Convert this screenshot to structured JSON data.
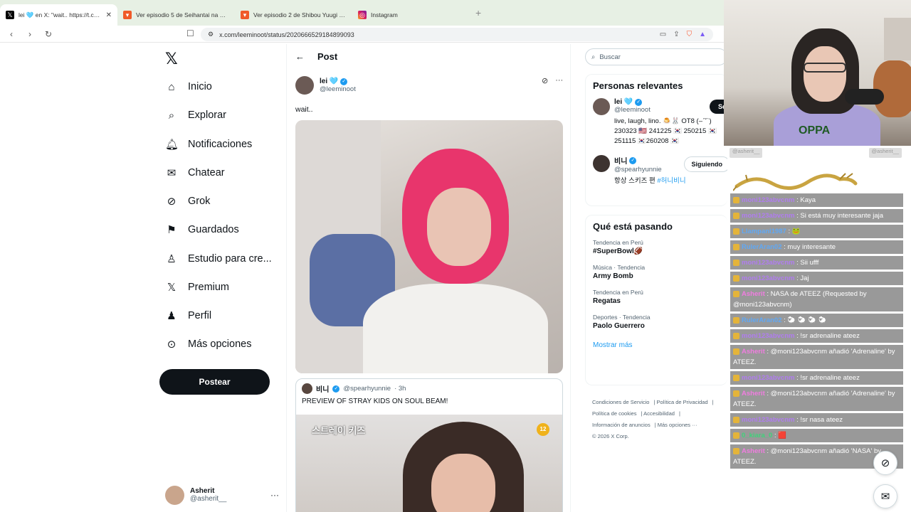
{
  "browser": {
    "tabs": [
      {
        "title": "lei 🩵 en X: \"wait.. https://t.co/jfO",
        "favicon": "x-logo",
        "active": true
      },
      {
        "title": "Ver episodio 5 de Seihantai na Kimi t",
        "favicon": "anime-icon",
        "active": false
      },
      {
        "title": "Ver episodio 2 de Shibou Yuugi de M",
        "favicon": "anime-icon",
        "active": false
      },
      {
        "title": "Instagram",
        "favicon": "instagram-icon",
        "active": false
      }
    ],
    "url": "x.com/leeminoot/status/2020666529184899093"
  },
  "nav": {
    "items": [
      {
        "label": "Inicio",
        "icon": "home-icon"
      },
      {
        "label": "Explorar",
        "icon": "search-icon"
      },
      {
        "label": "Notificaciones",
        "icon": "bell-icon"
      },
      {
        "label": "Chatear",
        "icon": "mail-icon"
      },
      {
        "label": "Grok",
        "icon": "grok-icon"
      },
      {
        "label": "Guardados",
        "icon": "bookmark-icon"
      },
      {
        "label": "Estudio para cre...",
        "icon": "studio-icon"
      },
      {
        "label": "Premium",
        "icon": "x-icon"
      },
      {
        "label": "Perfil",
        "icon": "person-icon"
      },
      {
        "label": "Más opciones",
        "icon": "more-icon"
      }
    ],
    "post_button": "Postear",
    "account": {
      "name": "Asherit",
      "handle": "@asherit__"
    }
  },
  "post": {
    "header": "Post",
    "author_name": "lei 🩵",
    "author_handle": "@leeminoot",
    "text": "wait..",
    "quote": {
      "name": "비니",
      "handle": "@spearhyunnie",
      "time": "· 3h",
      "text": "PREVIEW OF STRAY KIDS ON SOUL BEAM!",
      "logo_text": "스트레이 키즈",
      "age_badge": "12"
    }
  },
  "sidebar": {
    "search_placeholder": "Buscar",
    "people_title": "Personas relevantes",
    "people": [
      {
        "name": "lei 🩵",
        "handle": "@leeminoot",
        "bio": "live, laugh, lino. 🍮🐰 OT8 (–ˊ˘ˋ) 230323 🇺🇸 241225 🇰🇷 250215 🇰🇷 251115 🇰🇷260208 🇰🇷",
        "button": "Se"
      },
      {
        "name": "비니",
        "handle": "@spearhyunnie",
        "bio": "항상 스키즈 편 ",
        "bio_tag": "#허니비니",
        "button": "Siguiendo"
      }
    ],
    "trends_title": "Qué está pasando",
    "trends": [
      {
        "context": "Tendencia en Perú",
        "name": "#SuperBowl🏈"
      },
      {
        "context": "Música · Tendencia",
        "name": "Army Bomb"
      },
      {
        "context": "Tendencia en Perú",
        "name": "Regatas"
      },
      {
        "context": "Deportes · Tendencia",
        "name": "Paolo Guerrero"
      }
    ],
    "show_more": "Mostrar más",
    "footer": [
      "Condiciones de Servicio",
      "Política de Privacidad",
      "Política de cookies",
      "Accesibilidad",
      "Información de anuncios",
      "Más opciones ···",
      "© 2026 X Corp."
    ]
  },
  "stream": {
    "header_left": "@asherit__",
    "header_right": "@asherit__",
    "cam_shirt_text": "OPPA",
    "chat": [
      {
        "user": "moni123abvcnm",
        "color": "purple",
        "text": ": Kaya"
      },
      {
        "user": "moni123abvcnm",
        "color": "purple",
        "text": ": Si está muy interesante jaja"
      },
      {
        "user": "Llampanl1987",
        "color": "blue",
        "text": ": 🐸"
      },
      {
        "user": "RulerAran02",
        "color": "blue",
        "text": ": muy interesante"
      },
      {
        "user": "moni123abvcnm",
        "color": "purple",
        "text": ": Sii ufff"
      },
      {
        "user": "moni123abvcnm",
        "color": "purple",
        "text": ": Jaj"
      },
      {
        "user": "Asherit",
        "color": "pink",
        "text": ": NASA de ATEEZ (Requested by @moni123abvcnm)"
      },
      {
        "user": "RulerAran02",
        "color": "blue",
        "text": ": 🐑 🐑 🐑 🐑"
      },
      {
        "user": "moni123abvcnm",
        "color": "purple",
        "text": ": !sr adrenaline ateez"
      },
      {
        "user": "Asherit",
        "color": "pink",
        "text": ": @moni123abvcnm añadió 'Adrenaline' by ATEEZ."
      },
      {
        "user": "moni123abvcnm",
        "color": "purple",
        "text": ": !sr adrenaline ateez"
      },
      {
        "user": "Asherit",
        "color": "pink",
        "text": ": @moni123abvcnm añadió 'Adrenaline' by ATEEZ."
      },
      {
        "user": "moni123abvcnm",
        "color": "purple",
        "text": ": !sr nasa ateez"
      },
      {
        "user": "0_kiara_0",
        "color": "green",
        "text": ": 🟥"
      },
      {
        "user": "Asherit",
        "color": "pink",
        "text": ": @moni123abvcnm añadió 'NASA' by ATEEZ."
      }
    ]
  }
}
